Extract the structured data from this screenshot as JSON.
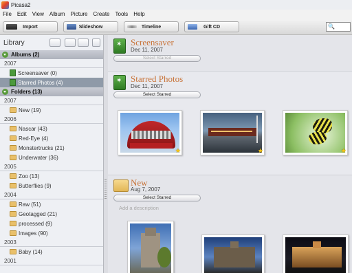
{
  "window": {
    "title": "Picasa2"
  },
  "menu": [
    "File",
    "Edit",
    "View",
    "Album",
    "Picture",
    "Create",
    "Tools",
    "Help"
  ],
  "toolbar": {
    "import": "Import",
    "slideshow": "Slideshow",
    "timeline": "Timeline",
    "giftcd": "Gift CD",
    "search_icon": "magnifier-icon"
  },
  "library": {
    "title": "Library",
    "albums_header": "Albums (2)",
    "albums_year": "2007",
    "albums": [
      {
        "label": "Screensaver (0)"
      },
      {
        "label": "Starred Photos (4)"
      }
    ],
    "folders_header": "Folders (13)",
    "folder_groups": [
      {
        "year": "2007",
        "items": [
          "New (19)"
        ]
      },
      {
        "year": "2006",
        "items": [
          "Nascar (43)",
          "Red-Eye (4)",
          "Monstertrucks (21)",
          "Underwater (36)"
        ]
      },
      {
        "year": "2005",
        "items": [
          "Zoo (13)",
          "Butterflies (9)"
        ]
      },
      {
        "year": "2004",
        "items": [
          "Raw (51)",
          "Geotagged (21)",
          "processed (9)",
          "Images (90)"
        ]
      },
      {
        "year": "2003",
        "items": [
          "Baby (14)"
        ]
      },
      {
        "year": "2001",
        "items": []
      }
    ]
  },
  "main": {
    "screensaver": {
      "title": "Screensaver",
      "date": "Dec 11, 2007",
      "button": "Select Starred"
    },
    "starred": {
      "title": "Starred Photos",
      "date": "Dec 11, 2007",
      "button": "Select Starred"
    },
    "new_folder": {
      "title": "New",
      "date": "Aug 7, 2007",
      "button": "Select Starred",
      "description_placeholder": "Add a description"
    }
  },
  "colors": {
    "section_title": "#c8743a",
    "selected_row": "#8f9aa8",
    "accent_green": "#4b9a3c"
  }
}
